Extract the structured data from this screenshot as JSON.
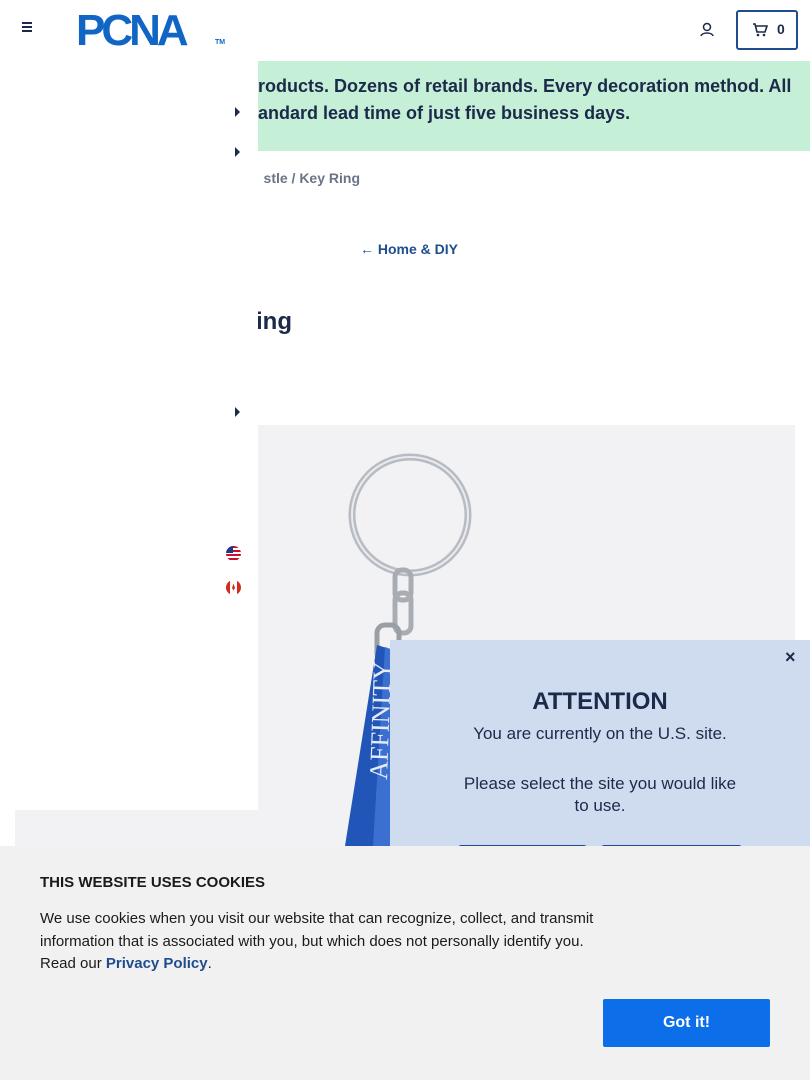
{
  "header": {
    "logo_text": "PCNA",
    "logo_tm": "TM",
    "cart_count": "0"
  },
  "banner": {
    "text": "Thousands of products. Dozens of retail brands. Every decoration method. All with a standard lead time of just five business days.",
    "visible_text": "roducts. Dozens of retail brands. Every decoration method. All",
    "visible_text_2": "andard lead time of just five business days."
  },
  "breadcrumb": {
    "text": "stle / Key Ring"
  },
  "back_link": {
    "arrow": "←",
    "label": "Home & DIY"
  },
  "product": {
    "title_visible": "ing",
    "image_text": "AFFINITY"
  },
  "attention": {
    "close": "×",
    "title": "ATTENTION",
    "line1": "You are currently on the U.S. site.",
    "line2": "Please select the site you would like to use."
  },
  "cookie": {
    "title": "THIS WEBSITE USES COOKIES",
    "text": "We use cookies when you visit our website that can recognize, collect, and transmit information that is associated with you, but which does not personally identify you. Read our ",
    "link": "Privacy Policy",
    "period": ".",
    "button": "Got it!"
  },
  "colors": {
    "brand_blue": "#1166c5",
    "banner_green": "#c6efd8",
    "modal_bg": "#cfdcf0",
    "cookie_button": "#0c6ee8"
  }
}
